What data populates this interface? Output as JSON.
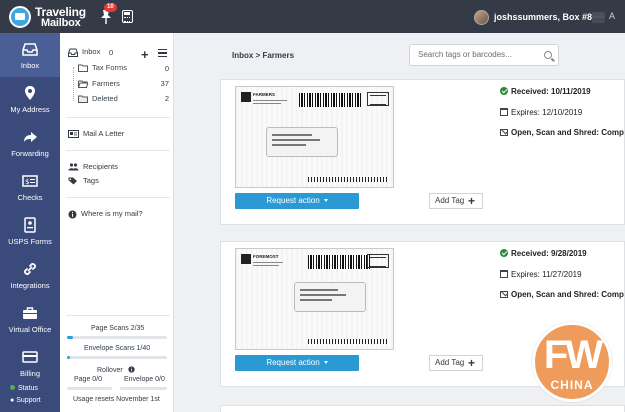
{
  "topbar": {
    "logo_line1": "Traveling",
    "logo_line2": "Mailbox",
    "notif_count": "10",
    "user": "joshssummers, Box #8",
    "user_mask": "▒▒",
    "extra": "A"
  },
  "nav": {
    "items": [
      {
        "label": "Inbox",
        "icon": "inbox-icon"
      },
      {
        "label": "My Address",
        "icon": "location-pin-icon"
      },
      {
        "label": "Forwarding",
        "icon": "forward-arrow-icon"
      },
      {
        "label": "Checks",
        "icon": "check-icon"
      },
      {
        "label": "USPS Forms",
        "icon": "form-icon"
      },
      {
        "label": "Integrations",
        "icon": "link-icon"
      },
      {
        "label": "Virtual Office",
        "icon": "briefcase-icon"
      },
      {
        "label": "Billing",
        "icon": "card-icon"
      }
    ],
    "status": "Status",
    "support": "Support"
  },
  "sidebar": {
    "inbox_label": "Inbox",
    "inbox_count": "0",
    "folders": [
      {
        "label": "Tax Forms",
        "count": "0"
      },
      {
        "label": "Farmers",
        "count": "37"
      },
      {
        "label": "Deleted",
        "count": "2"
      }
    ],
    "mail_letter": "Mail A Letter",
    "recipients": "Recipients",
    "tags": "Tags",
    "where": "Where is my mail?",
    "page_scans": "Page Scans 2/35",
    "page_scans_fraction": 0.057,
    "envelope_scans": "Envelope Scans 1/40",
    "envelope_scans_fraction": 0.025,
    "rollover": "Rollover",
    "rollover_page": "Page 0/0",
    "rollover_envelope": "Envelope 0/0",
    "usage_resets": "Usage resets November 1st"
  },
  "main": {
    "breadcrumb": "Inbox > Farmers",
    "search_placeholder": "Search tags or barcodes...",
    "request_action": "Request action",
    "add_tag": "Add Tag",
    "items": [
      {
        "sender": "FARMERS",
        "received": "Received: 10/11/2019",
        "expires": "Expires: 12/10/2019",
        "action": "Open, Scan and Shred: Comp"
      },
      {
        "sender": "FOREMOST",
        "received": "Received: 9/28/2019",
        "expires": "Expires: 11/27/2019",
        "action": "Open, Scan and Shred: Comp"
      }
    ]
  },
  "watermark": {
    "big": "FW",
    "small": "CHINA"
  },
  "colors": {
    "topbar": "#343a46",
    "nav": "#3a4a7a",
    "nav_active": "#4a5f96",
    "accent": "#2b9ad4",
    "received_check": "#2e8b3a",
    "watermark": "#ee9b5b"
  }
}
